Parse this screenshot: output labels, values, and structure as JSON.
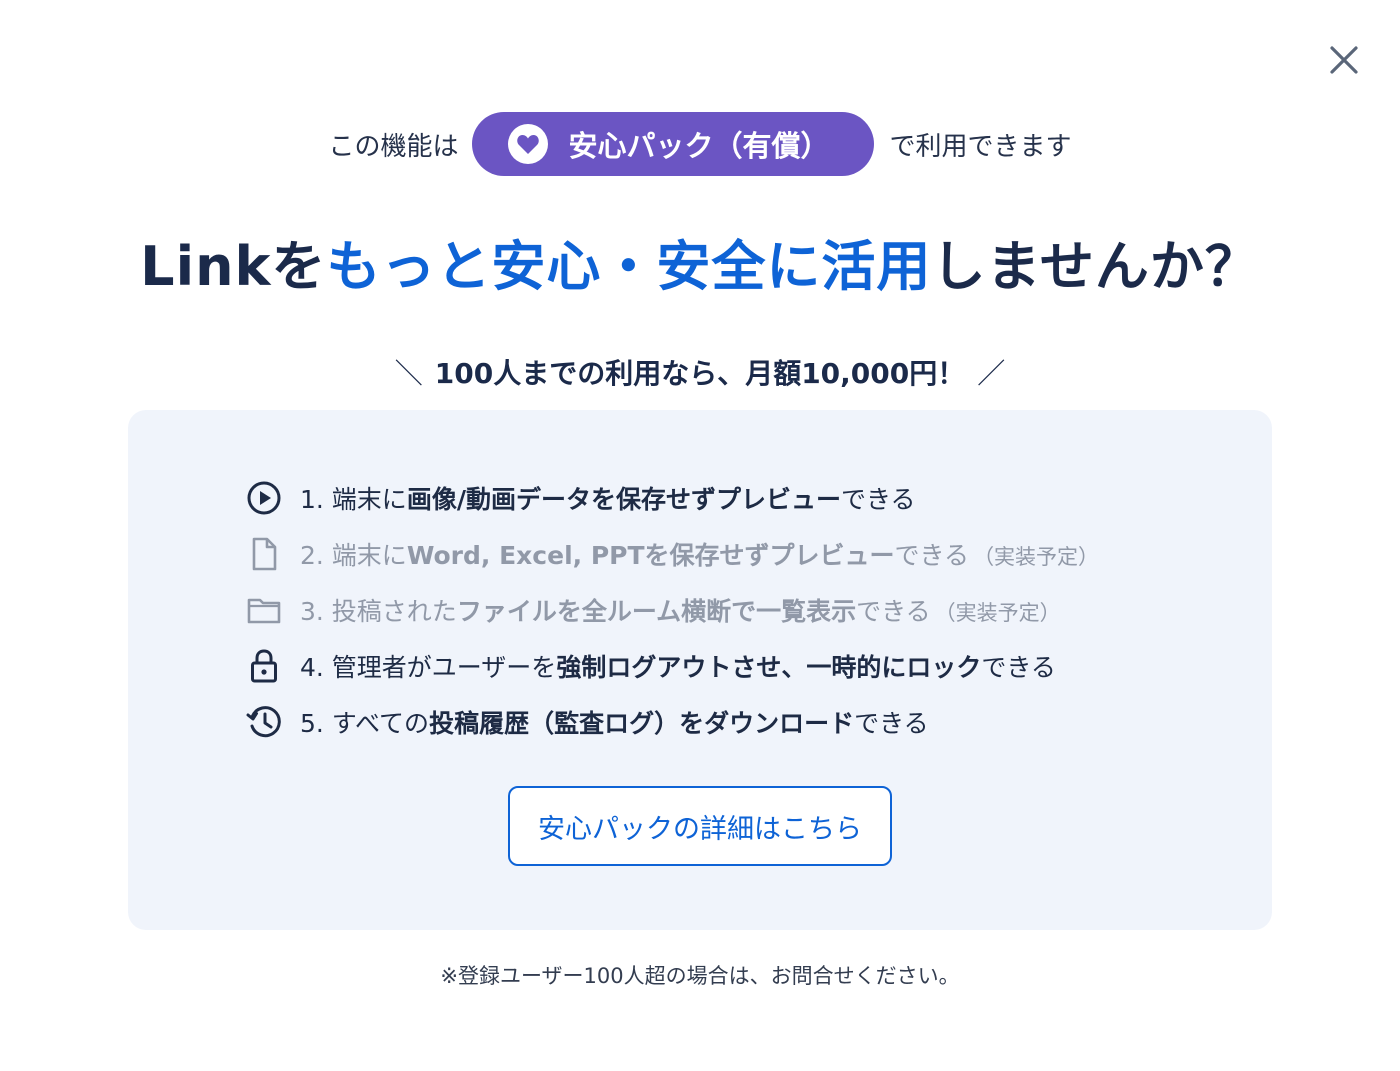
{
  "close": {
    "icon": "close-icon"
  },
  "availability": {
    "prefix": "この機能は",
    "pill_label": "安心パック（有償）",
    "pill_icon": "heart-icon",
    "suffix": "で利用できます",
    "pill_color": "#6b55c3"
  },
  "headline": {
    "part1": "Linkを",
    "highlight": "もっと安心・安全に活用",
    "part2": "しませんか？",
    "highlight_color": "#0e63d6"
  },
  "price": {
    "left_slash": "＼",
    "text": "100人までの利用なら、月額10,000円！",
    "right_slash": "／"
  },
  "features": [
    {
      "icon": "play-circle-icon",
      "state": "active",
      "segments": [
        {
          "t": "1. 端末に",
          "b": false
        },
        {
          "t": "画像/動画データを保存せずプレビュー",
          "b": true
        },
        {
          "t": "できる",
          "b": false
        }
      ],
      "note": ""
    },
    {
      "icon": "document-icon",
      "state": "muted",
      "segments": [
        {
          "t": "2. 端末に",
          "b": false
        },
        {
          "t": "Word, Excel, PPTを保存せずプレビュー",
          "b": true
        },
        {
          "t": "できる",
          "b": false
        }
      ],
      "note": "（実装予定）"
    },
    {
      "icon": "folder-icon",
      "state": "muted",
      "segments": [
        {
          "t": "3. 投稿された",
          "b": false
        },
        {
          "t": "ファイルを全ルーム横断で一覧表示",
          "b": true
        },
        {
          "t": "できる",
          "b": false
        }
      ],
      "note": "（実装予定）"
    },
    {
      "icon": "lock-icon",
      "state": "active",
      "segments": [
        {
          "t": "4. 管理者がユーザーを",
          "b": false
        },
        {
          "t": "強制ログアウトさせ、一時的にロック",
          "b": true
        },
        {
          "t": "できる",
          "b": false
        }
      ],
      "note": ""
    },
    {
      "icon": "history-icon",
      "state": "active",
      "segments": [
        {
          "t": "5. すべての",
          "b": false
        },
        {
          "t": "投稿履歴（監査ログ）をダウンロード",
          "b": true
        },
        {
          "t": "できる",
          "b": false
        }
      ],
      "note": ""
    }
  ],
  "detail_button": {
    "label": "安心パックの詳細はこちら"
  },
  "footnote": "※登録ユーザー100人超の場合は、お問合せください。"
}
